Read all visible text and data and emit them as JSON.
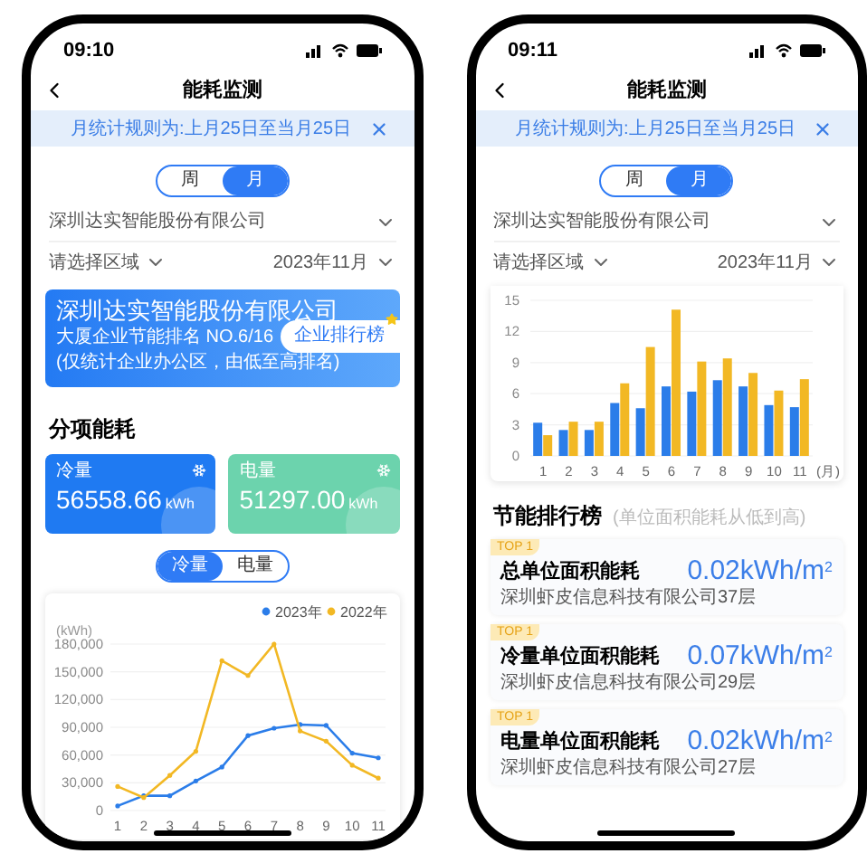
{
  "phones": [
    {
      "status_bar": {
        "time": "09:10"
      },
      "nav": {
        "title": "能耗监测"
      },
      "notice": {
        "text": "月统计规则为:上月25日至当月25日"
      },
      "period_tabs": [
        {
          "label": "周",
          "selected": false
        },
        {
          "label": "月",
          "selected": true
        }
      ],
      "company_select": {
        "value": "深圳达实智能股份有限公司"
      },
      "area_select": {
        "value": "请选择区域"
      },
      "month_select": {
        "value": "2023年11月"
      },
      "ranking_banner": {
        "company": "深圳达实智能股份有限公司",
        "rank": "大厦企业节能排名 NO.6/16",
        "note": "(仅统计企业办公区，由低至高排名)",
        "button": "企业排行榜"
      },
      "category": {
        "title": "分项能耗",
        "tiles": [
          {
            "label": "冷量",
            "value": "56558.66",
            "unit": "kWh",
            "color": "#1f7af2"
          },
          {
            "label": "电量",
            "value": "51297.00",
            "unit": "kWh",
            "color": "#6cd3ad"
          }
        ]
      },
      "energy_tabs": [
        {
          "label": "冷量",
          "selected": true
        },
        {
          "label": "电量",
          "selected": false
        }
      ],
      "chart_card": {
        "chart_data": {
          "type": "line",
          "ylabel": "(kWh)",
          "grid": true,
          "legend": true,
          "categories": [
            "1",
            "2",
            "3",
            "4",
            "5",
            "6",
            "7",
            "8",
            "9",
            "10",
            "11"
          ],
          "series": [
            {
              "name": "2023年",
              "color": "#2b7de9",
              "values": [
                5000,
                16000,
                16000,
                32000,
                47000,
                81000,
                89000,
                93000,
                92000,
                62000,
                57000
              ]
            },
            {
              "name": "2022年",
              "color": "#f2b824",
              "values": [
                26000,
                14000,
                38000,
                64000,
                162000,
                146000,
                180000,
                86000,
                75000,
                49000,
                35000
              ]
            }
          ],
          "ylim": [
            0,
            180000
          ],
          "yticks": [
            0,
            {
              "value": 30000,
              "label": "30,000"
            },
            {
              "value": 60000,
              "label": "60,000"
            },
            {
              "value": 90000,
              "label": "90,000"
            },
            {
              "value": 120000,
              "label": "120,000"
            },
            {
              "value": 150000,
              "label": "150,000"
            },
            {
              "value": 180000,
              "label": "180,000"
            }
          ]
        }
      }
    },
    {
      "status_bar": {
        "time": "09:11"
      },
      "nav": {
        "title": "能耗监测"
      },
      "notice": {
        "text": "月统计规则为:上月25日至当月25日"
      },
      "period_tabs": [
        {
          "label": "周",
          "selected": false
        },
        {
          "label": "月",
          "selected": true
        }
      ],
      "company_select": {
        "value": "深圳达实智能股份有限公司"
      },
      "area_select": {
        "value": "请选择区域"
      },
      "month_select": {
        "value": "2023年11月"
      },
      "chart_card": {
        "chart_data": {
          "type": "bar",
          "xlabel": "(月)",
          "grid": true,
          "categories": [
            "1",
            "2",
            "3",
            "4",
            "5",
            "6",
            "7",
            "8",
            "9",
            "10",
            "11"
          ],
          "series": [
            {
              "color": "#2b7de9",
              "values": [
                3.2,
                2.5,
                2.5,
                5.1,
                4.6,
                6.7,
                6.2,
                7.3,
                6.7,
                4.9,
                4.7
              ]
            },
            {
              "color": "#f2b824",
              "values": [
                2.0,
                3.3,
                3.3,
                7.0,
                10.5,
                14.1,
                9.1,
                9.4,
                8.0,
                6.3,
                7.4
              ]
            }
          ],
          "ylim": [
            0,
            15
          ],
          "yticks": [
            0,
            3,
            6,
            9,
            12,
            15
          ]
        }
      },
      "ranking": {
        "title": "节能排行榜",
        "subtitle": "(单位面积能耗从低到高)",
        "items": [
          {
            "badge": "TOP 1",
            "name": "总单位面积能耗",
            "value": "0.02kWh/m$^{2}$",
            "company": "深圳虾皮信息科技有限公司37层"
          },
          {
            "badge": "TOP 1",
            "name": "冷量单位面积能耗",
            "value": "0.07kWh/m$^{2}$",
            "company": "深圳虾皮信息科技有限公司29层"
          },
          {
            "badge": "TOP 1",
            "name": "电量单位面积能耗",
            "value": "0.02kWh/m$^{2}$",
            "company": "深圳虾皮信息科技有限公司27层"
          }
        ]
      }
    }
  ]
}
